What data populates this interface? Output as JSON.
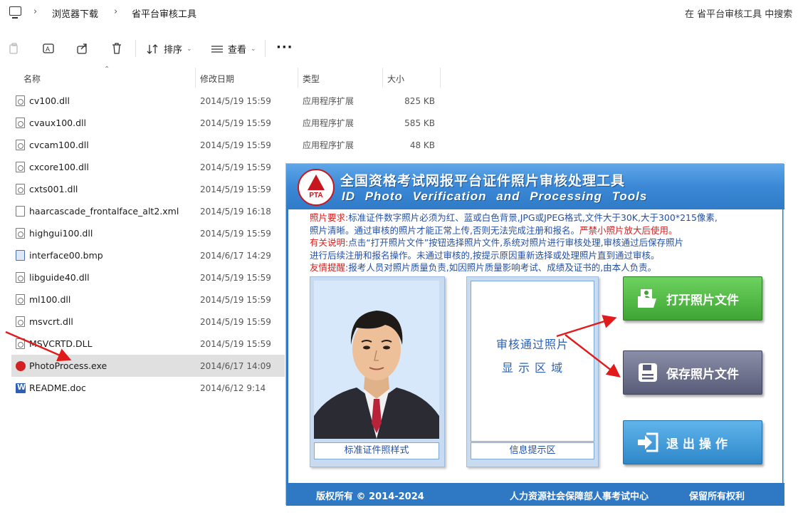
{
  "breadcrumb": {
    "items": [
      "浏览器下载",
      "省平台审核工具"
    ]
  },
  "search": {
    "placeholder": "在 省平台审核工具 中搜索"
  },
  "toolbar": {
    "sort_label": "排序",
    "view_label": "查看",
    "more_label": "···"
  },
  "columns": {
    "name": "名称",
    "date": "修改日期",
    "type": "类型",
    "size": "大小"
  },
  "files": [
    {
      "name": "cv100.dll",
      "date": "2014/5/19 15:59",
      "type": "应用程序扩展",
      "size": "825 KB",
      "icon": "dll-file-icon"
    },
    {
      "name": "cvaux100.dll",
      "date": "2014/5/19 15:59",
      "type": "应用程序扩展",
      "size": "585 KB",
      "icon": "dll-file-icon"
    },
    {
      "name": "cvcam100.dll",
      "date": "2014/5/19 15:59",
      "type": "应用程序扩展",
      "size": "48 KB",
      "icon": "dll-file-icon"
    },
    {
      "name": "cxcore100.dll",
      "date": "2014/5/19 15:59",
      "type": "",
      "size": "",
      "icon": "dll-file-icon"
    },
    {
      "name": "cxts001.dll",
      "date": "2014/5/19 15:59",
      "type": "",
      "size": "",
      "icon": "dll-file-icon"
    },
    {
      "name": "haarcascade_frontalface_alt2.xml",
      "date": "2014/5/19 16:18",
      "type": "",
      "size": "",
      "icon": "file-icon"
    },
    {
      "name": "highgui100.dll",
      "date": "2014/5/19 15:59",
      "type": "",
      "size": "",
      "icon": "dll-file-icon"
    },
    {
      "name": "interface00.bmp",
      "date": "2014/6/17 14:29",
      "type": "",
      "size": "",
      "icon": "bmp-file-icon"
    },
    {
      "name": "libguide40.dll",
      "date": "2014/5/19 15:59",
      "type": "",
      "size": "",
      "icon": "dll-file-icon"
    },
    {
      "name": "ml100.dll",
      "date": "2014/5/19 15:59",
      "type": "",
      "size": "",
      "icon": "dll-file-icon"
    },
    {
      "name": "msvcrt.dll",
      "date": "2014/5/19 15:59",
      "type": "",
      "size": "",
      "icon": "dll-file-icon"
    },
    {
      "name": "MSVCRTD.DLL",
      "date": "2014/5/19 15:59",
      "type": "",
      "size": "",
      "icon": "dll-file-icon"
    },
    {
      "name": "PhotoProcess.exe",
      "date": "2014/6/17 14:09",
      "type": "",
      "size": "",
      "icon": "exe-file-icon"
    },
    {
      "name": "README.doc",
      "date": "2014/6/12 9:14",
      "type": "",
      "size": "",
      "icon": "word-doc-icon"
    }
  ],
  "app": {
    "logo_text": "PTA",
    "title_cn": "全国资格考试网报平台证件照片审核处理工具",
    "title_en": "ID Photo Verification and Processing Tools",
    "notice": {
      "line1_label": "照片要求:",
      "line1_text": "标准证件数字照片必须为红、蓝或白色背景,JPG或JPEG格式,文件大于30K,大于300*215像素,",
      "line2_text": "照片清晰。通过审核的照片才能正常上传,否则无法完成注册和报名。",
      "line2_warn": "严禁小照片放大后使用。",
      "line3_label": "有关说明:",
      "line3_text": "点击“打开照片文件”按钮选择照片文件,系统对照片进行审核处理,审核通过后保存照片",
      "line4_text": "进行后续注册和报名操作。未通过审核的,按提示原因重新选择或处理照片直到通过审核。",
      "line5_label": "友情提醒:",
      "line5_text": "报考人员对照片质量负责,如因照片质量影响考试、成绩及证书的,由本人负责。"
    },
    "sample_caption": "标准证件照样式",
    "info_caption": "信息提示区",
    "display_line1": "审核通过照片",
    "display_line2": "显 示 区 域",
    "open_button": "打开照片文件",
    "save_button": "保存照片文件",
    "exit_button": "退出操作",
    "footer_copyright": "版权所有 © 2014-2024",
    "footer_org": "人力资源社会保障部人事考试中心",
    "footer_rights": "保留所有权利"
  },
  "colors": {
    "app_blue": "#2e78c4",
    "open_green": "#3ea433",
    "save_gray": "#585c79",
    "exit_blue": "#2e87c9",
    "arrow_red": "#e11b1b",
    "notice_red": "#d51e1e"
  }
}
